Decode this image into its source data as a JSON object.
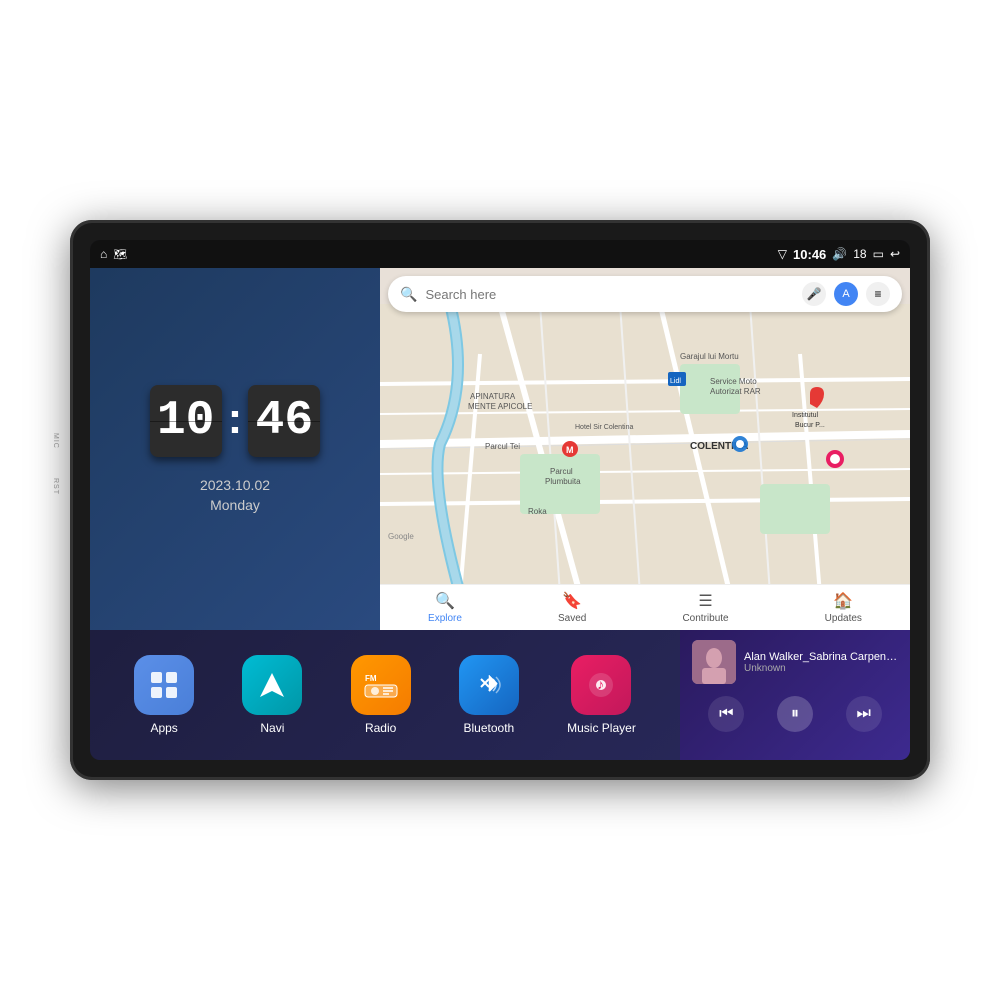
{
  "device": {
    "side_label_mic": "MIC",
    "side_label_rst": "RST"
  },
  "status_bar": {
    "wifi_icon": "▼",
    "time": "10:46",
    "volume_icon": "🔊",
    "battery_level": "18",
    "screen_icon": "▭",
    "back_icon": "↩",
    "home_icon": "⌂",
    "maps_icon": "🗺"
  },
  "clock": {
    "hour": "10",
    "minute": "46",
    "separator": ":",
    "date": "2023.10.02",
    "day": "Monday"
  },
  "map": {
    "search_placeholder": "Search here",
    "tabs": [
      {
        "label": "Explore",
        "icon": "🔍"
      },
      {
        "label": "Saved",
        "icon": "🔖"
      },
      {
        "label": "Contribute",
        "icon": "☰"
      },
      {
        "label": "Updates",
        "icon": "🏠"
      }
    ],
    "places": [
      "APINATURA MENTE APICOLE",
      "Garajul lui Mortu",
      "Lidl",
      "McDonald's",
      "Hotel Sir Colentina",
      "COLENTINA",
      "Parcul Plumbuita",
      "Parcul Tei",
      "Roka"
    ]
  },
  "apps": [
    {
      "label": "Apps",
      "icon": "⬡",
      "color": "#5B8FE8"
    },
    {
      "label": "Navi",
      "icon": "▲",
      "color": "#00BCD4"
    },
    {
      "label": "Radio",
      "icon": "📻",
      "color": "#F57C00"
    },
    {
      "label": "Bluetooth",
      "icon": "⛶",
      "color": "#2196F3"
    },
    {
      "label": "Music Player",
      "icon": "♪",
      "color": "#E91E63"
    }
  ],
  "music": {
    "title": "Alan Walker_Sabrina Carpenter_F...",
    "artist": "Unknown",
    "prev_icon": "⏮",
    "play_icon": "⏸",
    "next_icon": "⏭"
  }
}
